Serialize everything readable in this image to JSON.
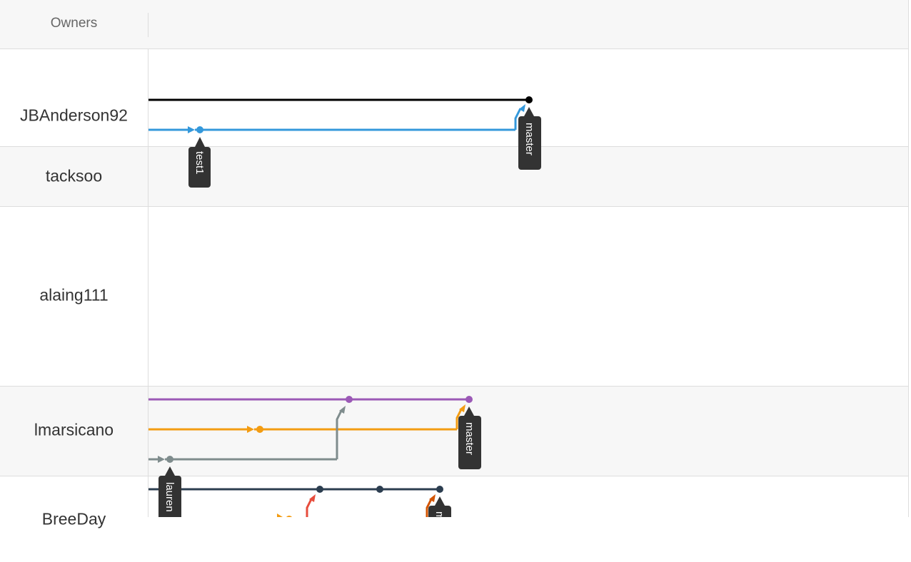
{
  "header": {
    "owners_label": "Owners"
  },
  "owners": [
    {
      "name": "JBAnderson92"
    },
    {
      "name": "tacksoo"
    },
    {
      "name": "alaing111"
    },
    {
      "name": "lmarsicano"
    },
    {
      "name": "BreeDay"
    }
  ],
  "branch_tags": {
    "jb_test1": "test1",
    "jb_master": "master",
    "lm_master": "master",
    "lm_laurent": "lauren",
    "bd_master": "m"
  },
  "colors": {
    "black": "#000000",
    "blue": "#3498db",
    "purple": "#9b59b6",
    "orange": "#f39c12",
    "gray": "#7f8c8d",
    "navy": "#2c3e50",
    "red": "#e74c3c",
    "dark_orange": "#d35400",
    "tag_bg": "#333333"
  }
}
